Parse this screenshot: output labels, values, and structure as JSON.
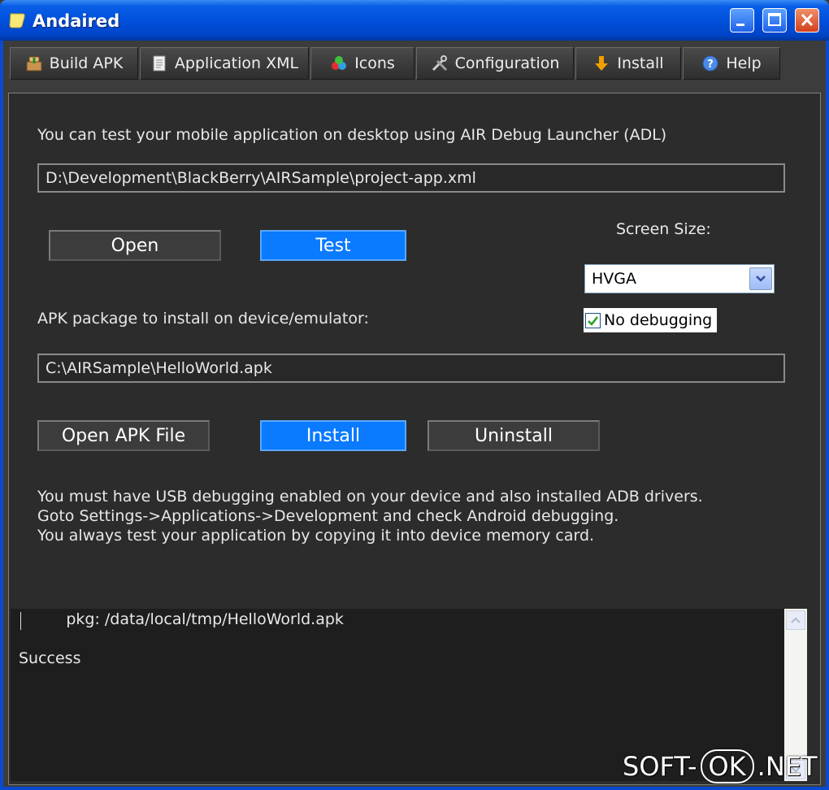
{
  "window": {
    "title": "Andaired"
  },
  "tabs": [
    {
      "label": "Build APK",
      "icon": "package-icon"
    },
    {
      "label": "Application XML",
      "icon": "document-icon"
    },
    {
      "label": "Icons",
      "icon": "shapes-icon"
    },
    {
      "label": "Configuration",
      "icon": "tools-icon"
    },
    {
      "label": "Install",
      "icon": "download-arrow-icon"
    },
    {
      "label": "Help",
      "icon": "help-icon"
    }
  ],
  "test_section": {
    "description": "You can test your mobile application on desktop using AIR Debug Launcher (ADL)",
    "xml_path": "D:\\Development\\BlackBerry\\AIRSample\\project-app.xml",
    "open_label": "Open",
    "test_label": "Test",
    "screen_size_label": "Screen Size:",
    "screen_size_value": "HVGA",
    "no_debugging_label": "No debugging",
    "no_debugging_checked": true
  },
  "install_section": {
    "apk_label": "APK package to install on device/emulator:",
    "apk_path": "C:\\AIRSample\\HelloWorld.apk",
    "open_apk_label": "Open APK File",
    "install_label": "Install",
    "uninstall_label": "Uninstall",
    "notes": [
      "You must have USB debugging enabled on your device and also installed ADB drivers.",
      "Goto Settings->Applications->Development and check Android debugging.",
      "You always test your application by copying it into device memory card."
    ]
  },
  "console": {
    "lines": [
      "        pkg: /data/local/tmp/HelloWorld.apk",
      "Success"
    ]
  },
  "watermark": {
    "left": "SOFT-",
    "middle": "OK",
    "right": ".NET"
  },
  "colors": {
    "titlebar": "#0050dc",
    "accent_button": "#0a7aff",
    "panel": "#2c2c2c"
  }
}
